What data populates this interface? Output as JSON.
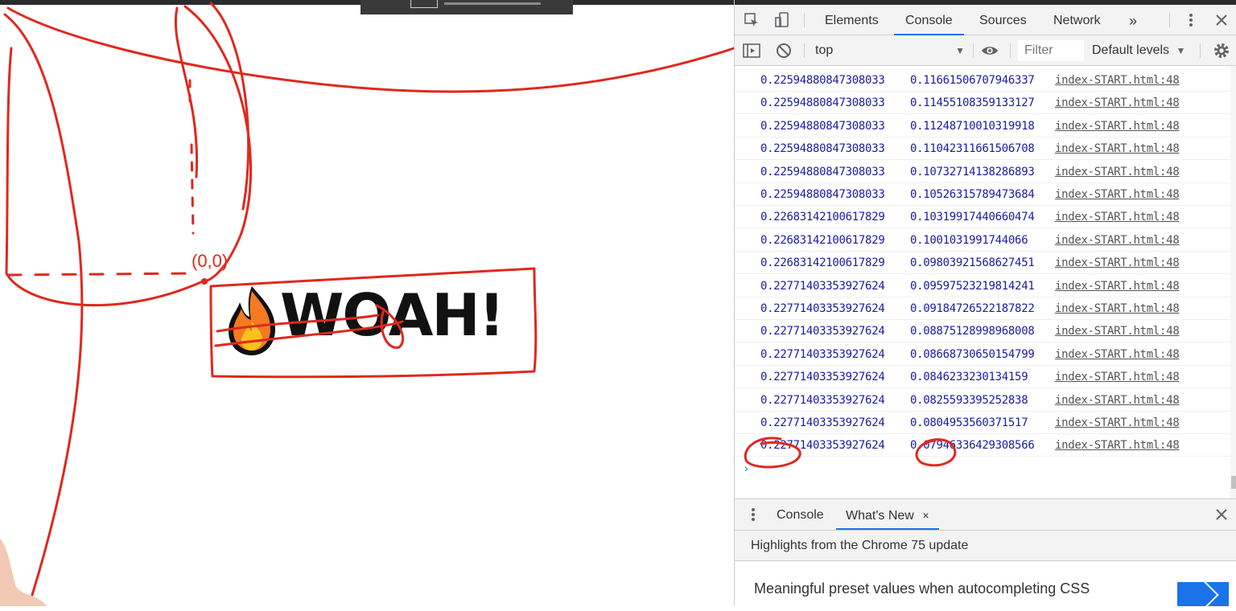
{
  "devtools": {
    "tabs": [
      "Elements",
      "Console",
      "Sources",
      "Network"
    ],
    "active_tab": "Console",
    "more_tabs_glyph": "»",
    "context": "top",
    "filter_placeholder": "Filter",
    "levels_label": "Default levels",
    "logs": [
      {
        "a": "0.22594880847308033",
        "b": "0.11661506707946337",
        "src": "index-START.html:48"
      },
      {
        "a": "0.22594880847308033",
        "b": "0.11455108359133127",
        "src": "index-START.html:48"
      },
      {
        "a": "0.22594880847308033",
        "b": "0.11248710010319918",
        "src": "index-START.html:48"
      },
      {
        "a": "0.22594880847308033",
        "b": "0.11042311661506708",
        "src": "index-START.html:48"
      },
      {
        "a": "0.22594880847308033",
        "b": "0.10732714138286893",
        "src": "index-START.html:48"
      },
      {
        "a": "0.22594880847308033",
        "b": "0.10526315789473684",
        "src": "index-START.html:48"
      },
      {
        "a": "0.22683142100617829",
        "b": "0.10319917440660474",
        "src": "index-START.html:48"
      },
      {
        "a": "0.22683142100617829",
        "b": "0.1001031991744066",
        "src": "index-START.html:48"
      },
      {
        "a": "0.22683142100617829",
        "b": "0.09803921568627451",
        "src": "index-START.html:48"
      },
      {
        "a": "0.22771403353927624",
        "b": "0.09597523219814241",
        "src": "index-START.html:48"
      },
      {
        "a": "0.22771403353927624",
        "b": "0.09184726522187822",
        "src": "index-START.html:48"
      },
      {
        "a": "0.22771403353927624",
        "b": "0.08875128998968008",
        "src": "index-START.html:48"
      },
      {
        "a": "0.22771403353927624",
        "b": "0.08668730650154799",
        "src": "index-START.html:48"
      },
      {
        "a": "0.22771403353927624",
        "b": "0.0846233230134159",
        "src": "index-START.html:48"
      },
      {
        "a": "0.22771403353927624",
        "b": "0.0825593395252838",
        "src": "index-START.html:48"
      },
      {
        "a": "0.22771403353927624",
        "b": "0.0804953560371517",
        "src": "index-START.html:48"
      },
      {
        "a": "0.22771403353927624",
        "b": "0.07946336429308566",
        "src": "index-START.html:48"
      }
    ],
    "prompt_glyph": "›",
    "drawer_tabs": [
      "Console",
      "What's New"
    ],
    "drawer_close_glyph": "×",
    "whats_new_heading": "Highlights from the Chrome 75 update",
    "whats_new_item": "Meaningful preset values when autocompleting CSS"
  },
  "page": {
    "headline": "WOAH!",
    "sketch_label": "(0,0)"
  },
  "colors": {
    "annotation_red": "#e0281e",
    "console_value_blue": "#1a1aa6",
    "active_tab_blue": "#1a73e8"
  },
  "icons": {
    "inspect": "inspect-element-icon",
    "device": "device-toolbar-icon",
    "menu": "kebab-menu-icon",
    "close": "close-icon",
    "sidebar": "console-sidebar-icon",
    "clear": "clear-console-icon",
    "eye": "live-expression-eye-icon",
    "settings": "gear-icon",
    "flame": "fire-emoji-icon"
  }
}
